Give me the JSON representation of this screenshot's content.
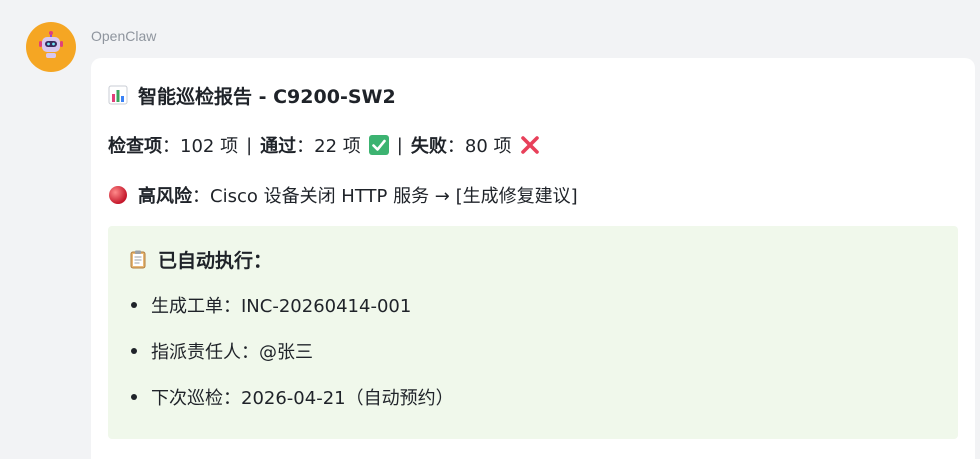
{
  "message": {
    "sender": "OpenClaw",
    "avatar_icon": "robot-icon",
    "title": "智能巡检报告 - C9200-SW2",
    "title_icon": "bar-chart-icon",
    "stats": {
      "checked_label": "检查项",
      "checked_value": "102 项",
      "separator": "|",
      "passed_label": "通过",
      "passed_value": "22 项",
      "failed_label": "失败",
      "failed_value": "80 项"
    },
    "colon": "：",
    "risk": {
      "icon": "red-circle-icon",
      "label": "高风险",
      "text": "Cisco 设备关闭 HTTP 服务 → [生成修复建议]"
    },
    "auto_actions": {
      "icon": "clipboard-icon",
      "heading": "已自动执行：",
      "items": [
        "生成工单：INC-20260414-001",
        "指派责任人：@张三",
        "下次巡检：2026-04-21（自动预约）"
      ]
    }
  },
  "colors": {
    "page_bg": "#f2f3f5",
    "bubble_bg": "#ffffff",
    "avatar_bg": "#f5a623",
    "auto_box_bg": "#f0f8eb",
    "pass_green": "#3cb371",
    "fail_red": "#e8405a",
    "risk_red": "#d9303f"
  }
}
